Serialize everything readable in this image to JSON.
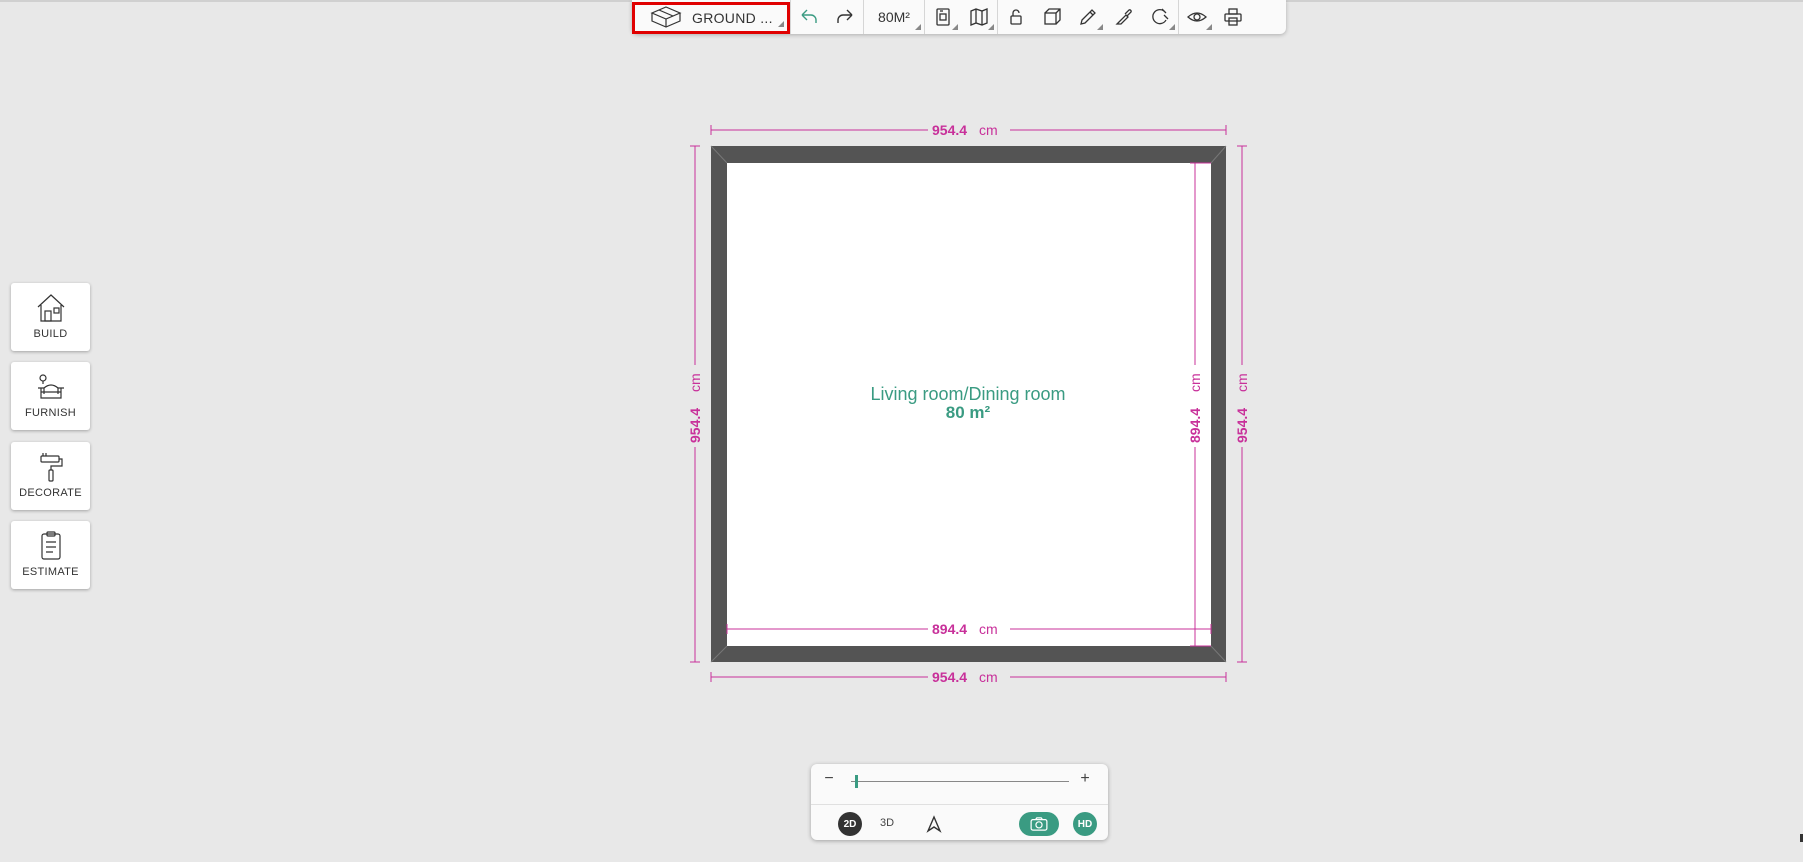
{
  "toolbar": {
    "level_label": "GROUND ...",
    "area_label": "80M²",
    "buttons": [
      "level-icon",
      "undo-icon",
      "redo-icon",
      "document-icon",
      "map-icon",
      "lock-icon",
      "cube-icon",
      "pencil-icon",
      "eyedropper-icon",
      "magnet-icon",
      "eye-icon",
      "print-icon"
    ]
  },
  "sidebar": {
    "items": [
      {
        "label": "BUILD",
        "icon": "house-icon"
      },
      {
        "label": "FURNISH",
        "icon": "sofa-icon"
      },
      {
        "label": "DECORATE",
        "icon": "paint-roller-icon"
      },
      {
        "label": "ESTIMATE",
        "icon": "clipboard-icon"
      }
    ]
  },
  "plan": {
    "room_name": "Living room/Dining room",
    "room_area": "80 m²",
    "unit": "cm",
    "dims": {
      "top": "954.4",
      "bottom_outer": "954.4",
      "bottom_inner": "894.4",
      "left": "954.4",
      "right_outer": "954.4",
      "right_inner": "894.4"
    }
  },
  "bottom_panel": {
    "zoom_minus": "−",
    "zoom_plus": "+",
    "zoom_level": 0.02,
    "mode_2d": "2D",
    "mode_3d": "3D",
    "hd": "HD"
  },
  "colors": {
    "accent": "#3a9b82",
    "dimension": "#c8309a",
    "wall": "#545454",
    "highlight": "#e00000"
  }
}
